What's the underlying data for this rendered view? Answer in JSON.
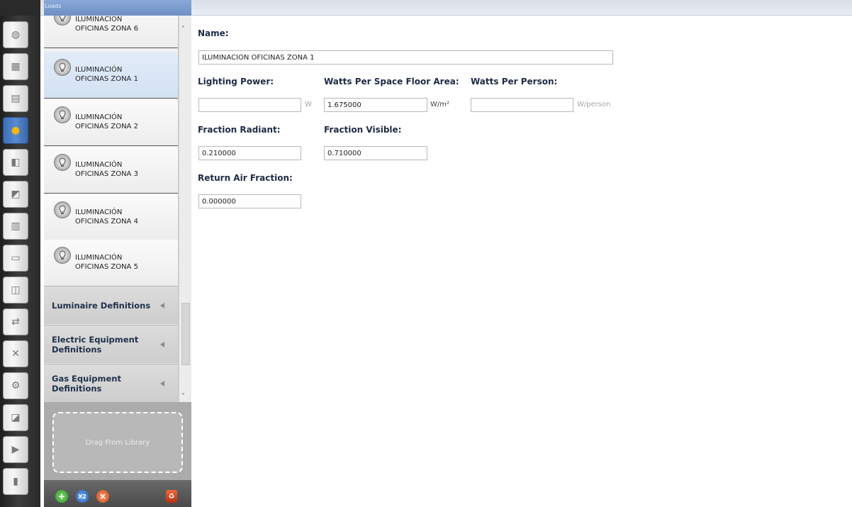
{
  "window": {
    "panel_title": "Loads"
  },
  "toolbar": {
    "icons": [
      "site-icon",
      "schedules-icon",
      "constructions-icon",
      "loads-icon",
      "space-types-icon",
      "geometry-icon",
      "facility-icon",
      "spaces-icon",
      "thermal-zones-icon",
      "hvac-systems-icon",
      "variables-icon",
      "simulation-settings-icon",
      "scripts-icon",
      "run-simulation-icon",
      "results-summary-icon"
    ],
    "active": "loads-icon"
  },
  "list": {
    "items": [
      {
        "line1": "ILUMINACIÓN",
        "line2": "OFICINAS ZONA  6"
      },
      {
        "line1": "ILUMINACIÓN",
        "line2": "OFICINAS ZONA 1",
        "selected": true
      },
      {
        "line1": "ILUMINACIÓN",
        "line2": "OFICINAS ZONA 2"
      },
      {
        "line1": "ILUMINACIÓN",
        "line2": "OFICINAS ZONA 3"
      },
      {
        "line1": "ILUMINACIÓN",
        "line2": "OFICINAS ZONA 4"
      },
      {
        "line1": "ILUMINACIÓN",
        "line2": "OFICINAS ZONA 5"
      }
    ],
    "sections": [
      {
        "label": "Luminaire Definitions"
      },
      {
        "label": "Electric Equipment Definitions"
      },
      {
        "label": "Gas Equipment Definitions"
      }
    ],
    "drop_label": "Drag From Library"
  },
  "actions": {
    "copy_label": "X2"
  },
  "form": {
    "name_label": "Name:",
    "name_value": "ILUMINACIÓN OFICINAS ZONA 1",
    "lighting_power_label": "Lighting Power:",
    "lighting_power_value": "",
    "lighting_power_unit": "W",
    "watts_area_label": "Watts Per Space Floor Area:",
    "watts_area_value": "1.675000",
    "watts_area_unit": "W/m²",
    "watts_person_label": "Watts Per Person:",
    "watts_person_value": "",
    "watts_person_unit": "W/person",
    "fraction_radiant_label": "Fraction Radiant:",
    "fraction_radiant_value": "0.210000",
    "fraction_visible_label": "Fraction Visible:",
    "fraction_visible_value": "0.710000",
    "return_air_label": "Return Air Fraction:",
    "return_air_value": "0.000000"
  }
}
